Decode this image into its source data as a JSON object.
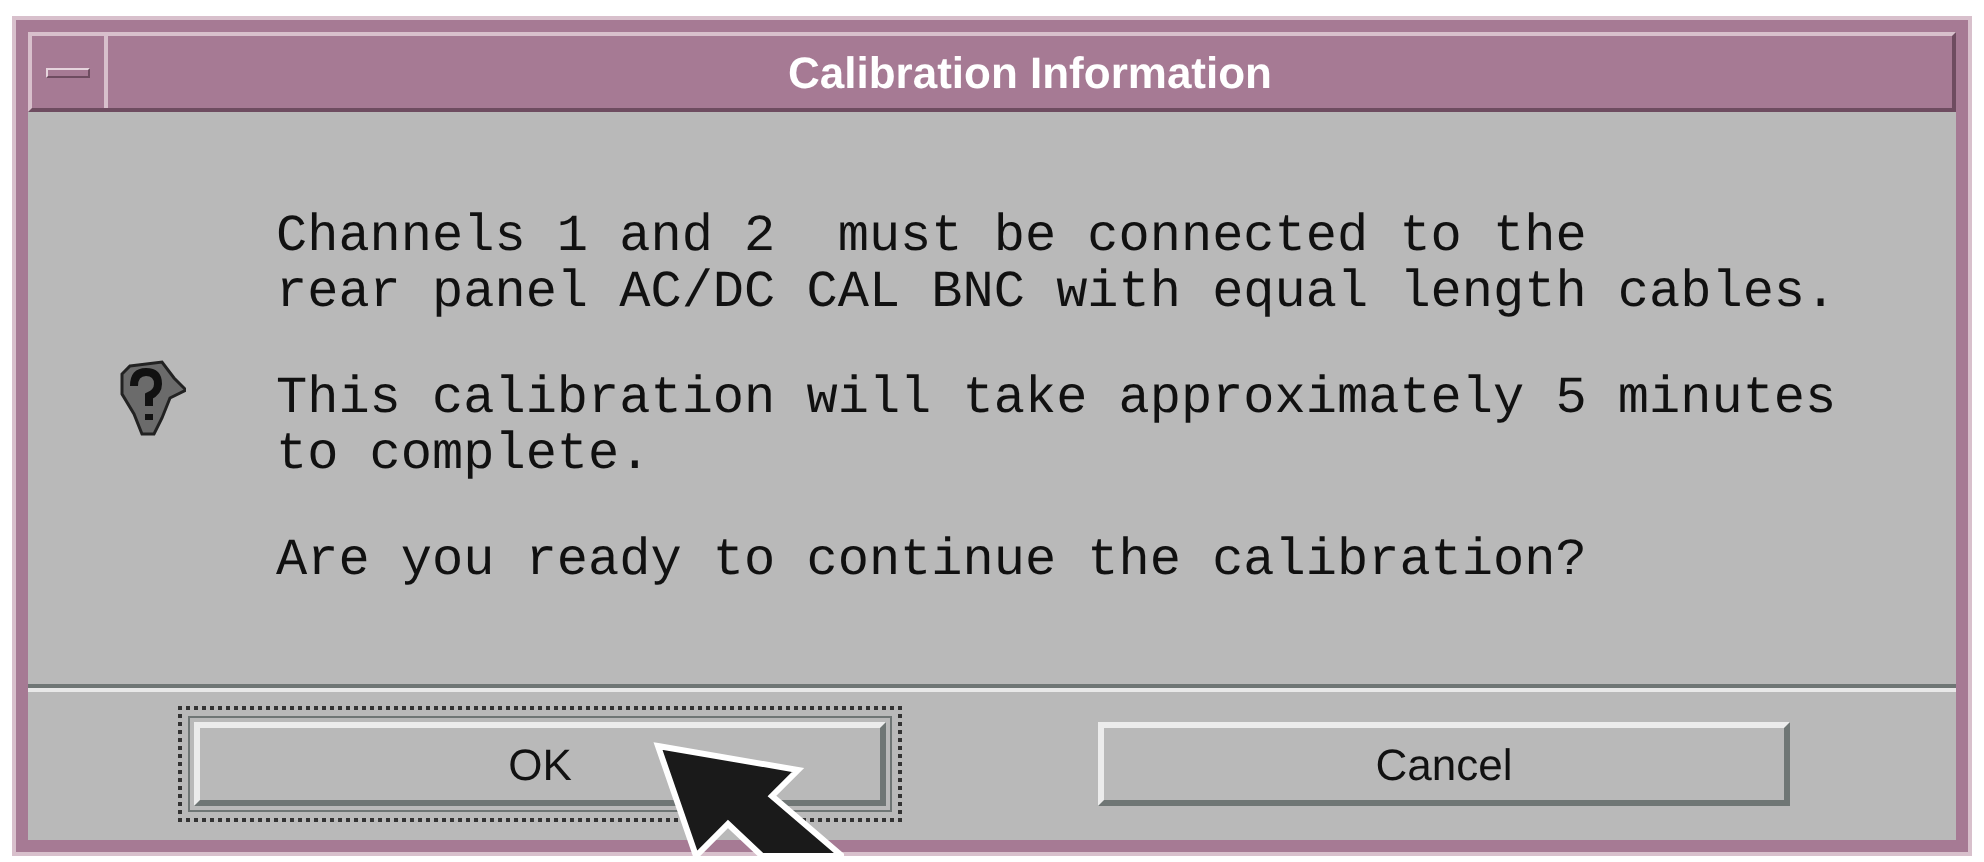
{
  "window": {
    "title": "Calibration Information"
  },
  "message": [
    "Channels 1 and 2  must be connected to the\nrear panel AC/DC CAL BNC with equal length cables.",
    "This calibration will take approximately 5 minutes\nto complete.",
    "Are you ready to continue the calibration?"
  ],
  "buttons": [
    {
      "label": "OK",
      "default": true
    },
    {
      "label": "Cancel",
      "default": false
    }
  ]
}
